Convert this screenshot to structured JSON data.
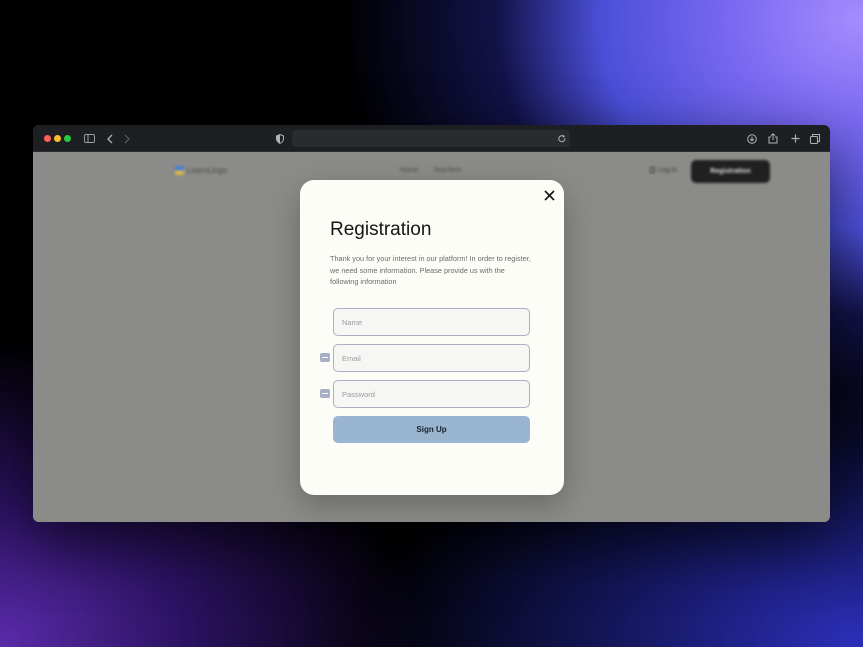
{
  "browser": {
    "url": "",
    "icons": [
      "sidebar-icon",
      "back-icon",
      "forward-icon",
      "shield-icon",
      "reload-icon",
      "download-icon",
      "share-icon",
      "new-tab-icon",
      "tabs-overview-icon"
    ]
  },
  "site": {
    "brand": "LearnLingo",
    "nav": {
      "home": "Home",
      "teachers": "Teachers"
    },
    "login": "Log in",
    "registration": "Registration"
  },
  "modal": {
    "title": "Registration",
    "description": "Thank you for your interest in our platform! In order to register, we need some information. Please provide us with the following information",
    "fields": {
      "name_placeholder": "Name",
      "email_placeholder": "Email",
      "password_placeholder": "Password"
    },
    "submit": "Sign Up",
    "close_icon": "close-icon"
  },
  "colors": {
    "modal_bg": "#fdfdf8",
    "button_bg": "#9ab5d0",
    "overlay": "#8b8b89",
    "titlebar": "#1e1f22"
  }
}
